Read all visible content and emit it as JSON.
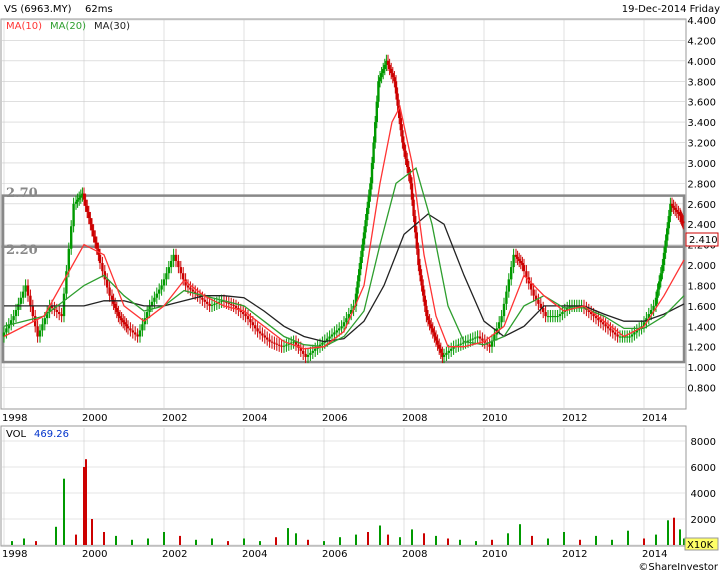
{
  "header": {
    "symbol": "VS (6963.MY)",
    "interval": "62ms",
    "date": "19-Dec-2014 Friday"
  },
  "chart_data": [
    {
      "type": "line",
      "title": "VS (6963.MY)",
      "legend": [
        "MA(10)",
        "MA(20)",
        "MA(30)"
      ],
      "colors": {
        "price_up": "#009900",
        "price_down": "#cc0000",
        "ma10": "#ff3333",
        "ma20": "#2e9e2e",
        "ma30": "#222222",
        "band": "#888888",
        "grid": "#cccccc"
      },
      "ylim": [
        0.6,
        4.4
      ],
      "y_ticks": [
        "0.800",
        "1.000",
        "1.200",
        "1.400",
        "1.600",
        "1.800",
        "2.000",
        "2.200",
        "2.400",
        "2.600",
        "2.800",
        "3.000",
        "3.200",
        "3.400",
        "3.600",
        "3.800",
        "4.000",
        "4.200",
        "4.400"
      ],
      "x_ticks": [
        "1998",
        "2000",
        "2002",
        "2004",
        "2006",
        "2008",
        "2010",
        "2012",
        "2014"
      ],
      "last_price": "2.410",
      "annotations": [
        {
          "label": "2.70",
          "y": 2.68
        },
        {
          "label": "2.20",
          "y": 2.18
        }
      ],
      "grid": true,
      "price": [
        [
          1998.0,
          1.3
        ],
        [
          1998.3,
          1.5
        ],
        [
          1998.6,
          1.8
        ],
        [
          1998.9,
          1.3
        ],
        [
          1999.2,
          1.6
        ],
        [
          1999.5,
          1.5
        ],
        [
          1999.8,
          2.6
        ],
        [
          2000.0,
          2.7
        ],
        [
          2000.2,
          2.4
        ],
        [
          2000.4,
          2.1
        ],
        [
          2000.7,
          1.7
        ],
        [
          2000.9,
          1.5
        ],
        [
          2001.1,
          1.4
        ],
        [
          2001.4,
          1.3
        ],
        [
          2001.7,
          1.6
        ],
        [
          2002.0,
          1.8
        ],
        [
          2002.3,
          2.1
        ],
        [
          2002.6,
          1.8
        ],
        [
          2002.9,
          1.7
        ],
        [
          2003.2,
          1.6
        ],
        [
          2003.5,
          1.65
        ],
        [
          2003.8,
          1.6
        ],
        [
          2004.1,
          1.5
        ],
        [
          2004.4,
          1.35
        ],
        [
          2004.7,
          1.25
        ],
        [
          2005.0,
          1.2
        ],
        [
          2005.3,
          1.25
        ],
        [
          2005.6,
          1.1
        ],
        [
          2005.9,
          1.2
        ],
        [
          2006.2,
          1.3
        ],
        [
          2006.5,
          1.4
        ],
        [
          2006.8,
          1.6
        ],
        [
          2007.0,
          2.2
        ],
        [
          2007.2,
          2.8
        ],
        [
          2007.4,
          3.8
        ],
        [
          2007.6,
          4.0
        ],
        [
          2007.8,
          3.8
        ],
        [
          2008.0,
          3.2
        ],
        [
          2008.2,
          2.8
        ],
        [
          2008.4,
          2.0
        ],
        [
          2008.6,
          1.5
        ],
        [
          2008.8,
          1.3
        ],
        [
          2009.0,
          1.1
        ],
        [
          2009.3,
          1.2
        ],
        [
          2009.6,
          1.25
        ],
        [
          2009.9,
          1.3
        ],
        [
          2010.2,
          1.2
        ],
        [
          2010.5,
          1.5
        ],
        [
          2010.8,
          2.1
        ],
        [
          2011.0,
          2.0
        ],
        [
          2011.3,
          1.7
        ],
        [
          2011.6,
          1.5
        ],
        [
          2011.9,
          1.5
        ],
        [
          2012.2,
          1.6
        ],
        [
          2012.5,
          1.6
        ],
        [
          2012.8,
          1.5
        ],
        [
          2013.1,
          1.4
        ],
        [
          2013.4,
          1.3
        ],
        [
          2013.7,
          1.3
        ],
        [
          2014.0,
          1.4
        ],
        [
          2014.3,
          1.6
        ],
        [
          2014.5,
          2.0
        ],
        [
          2014.7,
          2.6
        ],
        [
          2014.9,
          2.5
        ],
        [
          2015.0,
          2.41
        ]
      ],
      "ma10": [
        [
          1998.0,
          1.3
        ],
        [
          1999.0,
          1.5
        ],
        [
          2000.0,
          2.2
        ],
        [
          2000.5,
          2.1
        ],
        [
          2001.0,
          1.6
        ],
        [
          2001.5,
          1.45
        ],
        [
          2002.0,
          1.6
        ],
        [
          2002.5,
          1.85
        ],
        [
          2003.0,
          1.7
        ],
        [
          2003.5,
          1.6
        ],
        [
          2004.0,
          1.55
        ],
        [
          2004.5,
          1.4
        ],
        [
          2005.0,
          1.25
        ],
        [
          2005.5,
          1.18
        ],
        [
          2006.0,
          1.2
        ],
        [
          2006.5,
          1.35
        ],
        [
          2007.0,
          1.8
        ],
        [
          2007.4,
          2.8
        ],
        [
          2007.7,
          3.4
        ],
        [
          2007.9,
          3.55
        ],
        [
          2008.2,
          3.0
        ],
        [
          2008.5,
          2.1
        ],
        [
          2008.8,
          1.5
        ],
        [
          2009.1,
          1.2
        ],
        [
          2009.5,
          1.2
        ],
        [
          2010.0,
          1.25
        ],
        [
          2010.5,
          1.4
        ],
        [
          2011.0,
          1.9
        ],
        [
          2011.5,
          1.7
        ],
        [
          2012.0,
          1.55
        ],
        [
          2012.5,
          1.6
        ],
        [
          2013.0,
          1.45
        ],
        [
          2013.5,
          1.3
        ],
        [
          2014.0,
          1.4
        ],
        [
          2014.5,
          1.7
        ],
        [
          2015.0,
          2.05
        ]
      ],
      "ma20": [
        [
          1998.0,
          1.4
        ],
        [
          1999.0,
          1.5
        ],
        [
          2000.0,
          1.8
        ],
        [
          2000.5,
          1.9
        ],
        [
          2001.0,
          1.7
        ],
        [
          2001.5,
          1.55
        ],
        [
          2002.0,
          1.6
        ],
        [
          2002.5,
          1.75
        ],
        [
          2003.0,
          1.7
        ],
        [
          2003.5,
          1.65
        ],
        [
          2004.0,
          1.6
        ],
        [
          2004.5,
          1.45
        ],
        [
          2005.0,
          1.3
        ],
        [
          2005.5,
          1.22
        ],
        [
          2006.0,
          1.2
        ],
        [
          2006.5,
          1.3
        ],
        [
          2007.0,
          1.55
        ],
        [
          2007.4,
          2.2
        ],
        [
          2007.8,
          2.8
        ],
        [
          2008.3,
          2.95
        ],
        [
          2008.7,
          2.4
        ],
        [
          2009.1,
          1.6
        ],
        [
          2009.5,
          1.25
        ],
        [
          2010.0,
          1.22
        ],
        [
          2010.5,
          1.3
        ],
        [
          2011.0,
          1.6
        ],
        [
          2011.5,
          1.7
        ],
        [
          2012.0,
          1.58
        ],
        [
          2012.5,
          1.58
        ],
        [
          2013.0,
          1.5
        ],
        [
          2013.5,
          1.38
        ],
        [
          2014.0,
          1.38
        ],
        [
          2014.5,
          1.5
        ],
        [
          2015.0,
          1.7
        ]
      ],
      "ma30": [
        [
          1998.0,
          1.6
        ],
        [
          1999.0,
          1.6
        ],
        [
          2000.0,
          1.6
        ],
        [
          2000.5,
          1.65
        ],
        [
          2001.0,
          1.65
        ],
        [
          2001.5,
          1.6
        ],
        [
          2002.0,
          1.6
        ],
        [
          2002.5,
          1.65
        ],
        [
          2003.0,
          1.7
        ],
        [
          2003.5,
          1.7
        ],
        [
          2004.0,
          1.68
        ],
        [
          2004.5,
          1.55
        ],
        [
          2005.0,
          1.4
        ],
        [
          2005.5,
          1.3
        ],
        [
          2006.0,
          1.25
        ],
        [
          2006.5,
          1.28
        ],
        [
          2007.0,
          1.45
        ],
        [
          2007.5,
          1.8
        ],
        [
          2008.0,
          2.3
        ],
        [
          2008.6,
          2.5
        ],
        [
          2009.0,
          2.4
        ],
        [
          2009.5,
          1.9
        ],
        [
          2010.0,
          1.45
        ],
        [
          2010.5,
          1.3
        ],
        [
          2011.0,
          1.4
        ],
        [
          2011.5,
          1.6
        ],
        [
          2012.0,
          1.6
        ],
        [
          2012.5,
          1.6
        ],
        [
          2013.0,
          1.52
        ],
        [
          2013.5,
          1.45
        ],
        [
          2014.0,
          1.45
        ],
        [
          2014.5,
          1.52
        ],
        [
          2015.0,
          1.62
        ]
      ]
    },
    {
      "type": "bar",
      "legend": [
        "VOL",
        "469.26"
      ],
      "ylim": [
        0,
        9000
      ],
      "y_ticks": [
        "8000",
        "6000",
        "4000",
        "2000",
        "0"
      ],
      "x_ticks": [
        "1998",
        "2000",
        "2002",
        "2004",
        "2006",
        "2008",
        "2010",
        "2012",
        "2014"
      ],
      "unit": "X10K",
      "credit": "©ShareInvestor",
      "bars": [
        [
          1998.2,
          300,
          "g"
        ],
        [
          1998.5,
          500,
          "g"
        ],
        [
          1998.8,
          300,
          "r"
        ],
        [
          1999.3,
          1400,
          "g"
        ],
        [
          1999.5,
          5100,
          "g"
        ],
        [
          1999.8,
          800,
          "r"
        ],
        [
          2000.0,
          6000,
          "r"
        ],
        [
          2000.05,
          6600,
          "r"
        ],
        [
          2000.2,
          2000,
          "r"
        ],
        [
          2000.5,
          1000,
          "r"
        ],
        [
          2000.8,
          700,
          "g"
        ],
        [
          2001.2,
          400,
          "g"
        ],
        [
          2001.6,
          500,
          "g"
        ],
        [
          2002.0,
          1000,
          "g"
        ],
        [
          2002.4,
          700,
          "r"
        ],
        [
          2002.8,
          400,
          "g"
        ],
        [
          2003.2,
          500,
          "g"
        ],
        [
          2003.6,
          300,
          "r"
        ],
        [
          2004.0,
          500,
          "g"
        ],
        [
          2004.4,
          300,
          "g"
        ],
        [
          2004.8,
          600,
          "r"
        ],
        [
          2005.1,
          1300,
          "g"
        ],
        [
          2005.3,
          900,
          "g"
        ],
        [
          2005.6,
          400,
          "r"
        ],
        [
          2006.0,
          300,
          "g"
        ],
        [
          2006.4,
          600,
          "g"
        ],
        [
          2006.8,
          800,
          "g"
        ],
        [
          2007.1,
          1000,
          "r"
        ],
        [
          2007.4,
          1500,
          "g"
        ],
        [
          2007.6,
          800,
          "r"
        ],
        [
          2007.9,
          600,
          "g"
        ],
        [
          2008.2,
          1200,
          "g"
        ],
        [
          2008.5,
          900,
          "r"
        ],
        [
          2008.8,
          700,
          "g"
        ],
        [
          2009.1,
          500,
          "r"
        ],
        [
          2009.4,
          400,
          "g"
        ],
        [
          2009.8,
          300,
          "g"
        ],
        [
          2010.2,
          400,
          "r"
        ],
        [
          2010.6,
          900,
          "g"
        ],
        [
          2010.9,
          1600,
          "g"
        ],
        [
          2011.2,
          700,
          "r"
        ],
        [
          2011.6,
          500,
          "g"
        ],
        [
          2012.0,
          1000,
          "g"
        ],
        [
          2012.4,
          400,
          "r"
        ],
        [
          2012.8,
          700,
          "g"
        ],
        [
          2013.2,
          400,
          "g"
        ],
        [
          2013.6,
          1100,
          "g"
        ],
        [
          2014.0,
          500,
          "r"
        ],
        [
          2014.3,
          800,
          "g"
        ],
        [
          2014.6,
          1900,
          "g"
        ],
        [
          2014.75,
          2100,
          "r"
        ],
        [
          2014.9,
          1200,
          "g"
        ],
        [
          2015.0,
          500,
          "g"
        ]
      ]
    }
  ]
}
